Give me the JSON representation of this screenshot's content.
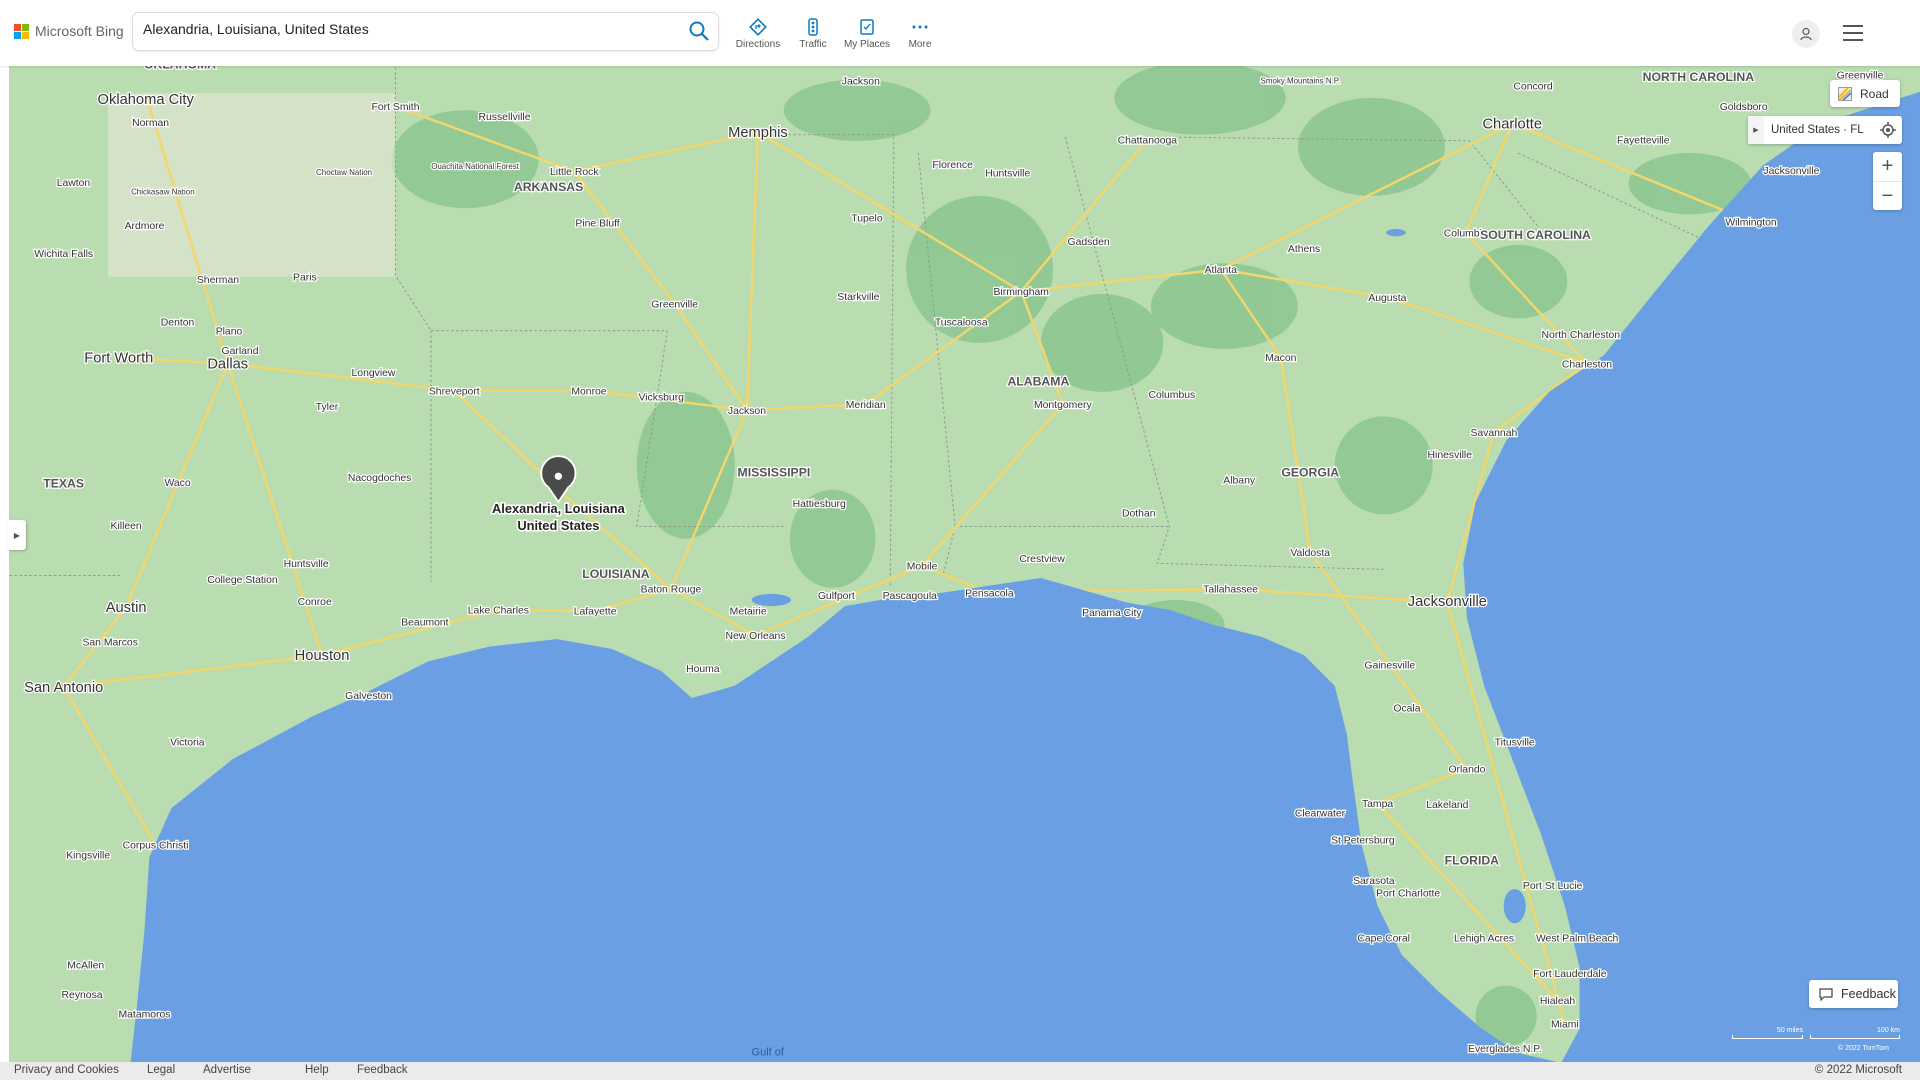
{
  "header": {
    "brand": "Microsoft Bing",
    "search_value": "Alexandria, Louisiana, United States",
    "tools": [
      "Directions",
      "Traffic",
      "My Places",
      "More"
    ]
  },
  "map_controls": {
    "style_label": "Road",
    "location_label": "United States · FL",
    "zoom_in": "+",
    "zoom_out": "−",
    "feedback_label": "Feedback",
    "scale_miles": "50 miles",
    "scale_km": "100 km",
    "tile_copyright": "© 2022 TomTom"
  },
  "pin": {
    "line1": "Alexandria, Louisiana",
    "line2": "United States"
  },
  "colors": {
    "water": "#6aa0e3",
    "land": "#b9dcb0",
    "forest": "#8cc58f",
    "road": "#f5d66a",
    "accent": "#0a7bc2"
  },
  "map": {
    "labels": [
      "OKLAHOMA",
      "Oklahoma City",
      "Norman",
      "Lawton",
      "Chickasaw Nation",
      "Choctaw Nation",
      "Ardmore",
      "Wichita Falls",
      "Sherman",
      "Paris",
      "Denton",
      "Plano",
      "Garland",
      "Fort Worth",
      "Dallas",
      "Longview",
      "Tyler",
      "Shreveport",
      "Nacogdoches",
      "TEXAS",
      "Waco",
      "Killeen",
      "Huntsville",
      "College Station",
      "Conroe",
      "Austin",
      "San Marcos",
      "Beaumont",
      "Lake Charles",
      "Houston",
      "San Antonio",
      "Galveston",
      "Victoria",
      "Corpus Christi",
      "Kingsville",
      "McAllen",
      "Reynosa",
      "Matamoros",
      "Fort Smith",
      "Russellville",
      "Ouachita National Forest",
      "Little Rock",
      "ARKANSAS",
      "Pine Bluff",
      "Greenville",
      "Monroe",
      "Vicksburg",
      "Jackson",
      "LOUISIANA",
      "Lafayette",
      "Baton Rouge",
      "Metairie",
      "New Orleans",
      "Houma",
      "Memphis",
      "Jackson",
      "Tupelo",
      "Starkville",
      "MISSISSIPPI",
      "Meridian",
      "Hattiesburg",
      "Gulfport",
      "Pascagoula",
      "Mobile",
      "Pensacola",
      "Crestview",
      "Panama City",
      "Dothan",
      "Florence",
      "Huntsville",
      "Chattanooga",
      "Gadsden",
      "Birmingham",
      "Tuscaloosa",
      "ALABAMA",
      "Montgomery",
      "Columbus",
      "Atlanta",
      "Athens",
      "Augusta",
      "Macon",
      "GEORGIA",
      "Albany",
      "Valdosta",
      "Tallahassee",
      "Smoky Mountains N.P.",
      "Concord",
      "Charlotte",
      "Columbia",
      "SOUTH CAROLINA",
      "NORTH CAROLINA",
      "Greenville",
      "Goldsboro",
      "Fayetteville",
      "Jacksonville",
      "Wilmington",
      "North Charleston",
      "Charleston",
      "Savannah",
      "Hinesville",
      "Jacksonville",
      "Gainesville",
      "Ocala",
      "Titusville",
      "Orlando",
      "Clearwater",
      "Tampa",
      "Lakeland",
      "St Petersburg",
      "FLORIDA",
      "Sarasota",
      "Port Charlotte",
      "Port St Lucie",
      "Cape Coral",
      "Lehigh Acres",
      "West Palm Beach",
      "Fort Lauderdale",
      "Hialeah",
      "Miami",
      "Everglades N.P.",
      "Gulf of"
    ]
  },
  "footer": {
    "links": [
      "Privacy and Cookies",
      "Legal",
      "Advertise",
      "Help",
      "Feedback"
    ],
    "copyright": "© 2022 Microsoft"
  }
}
